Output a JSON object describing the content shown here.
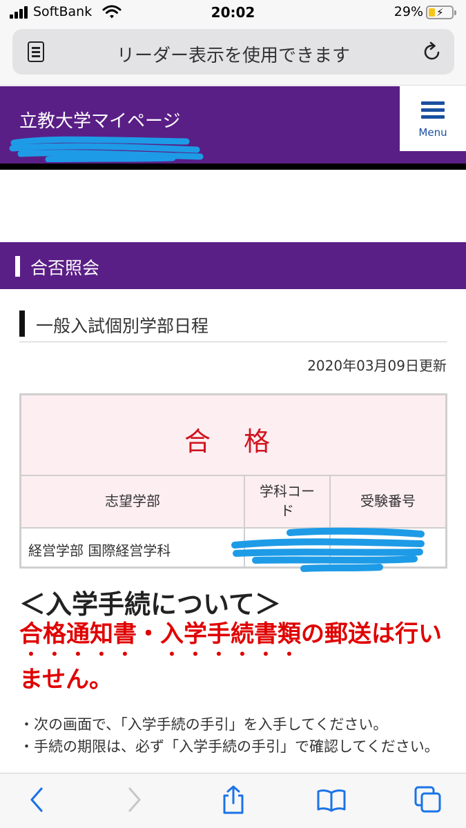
{
  "status_bar": {
    "carrier": "SoftBank",
    "time": "20:02",
    "battery_percent": "29%",
    "battery_level": 0.29
  },
  "address_bar": {
    "text": "リーダー表示を使用できます"
  },
  "site_header": {
    "title": "立教大学マイページ",
    "menu_label": "Menu",
    "brand_color": "#5a1f86"
  },
  "section": {
    "title": "合否照会",
    "subtitle": "一般入試個別学部日程",
    "updated": "2020年03月09日更新"
  },
  "result_table": {
    "result": "合 格",
    "headers": [
      "志望学部",
      "学科コード",
      "受験番号"
    ],
    "row": [
      "経営学部 国際経営学科",
      "",
      ""
    ]
  },
  "notice": {
    "heading": "＜入学手続について＞",
    "red_emphasis": "合格通知書・入学手続書類",
    "red_rest": "の郵送は行いません。",
    "items": [
      "・次の画面で、「入学手続の手引」を入手してください。",
      "・手続の期限は、必ず「入学手続の手引」で確認してください。"
    ]
  }
}
